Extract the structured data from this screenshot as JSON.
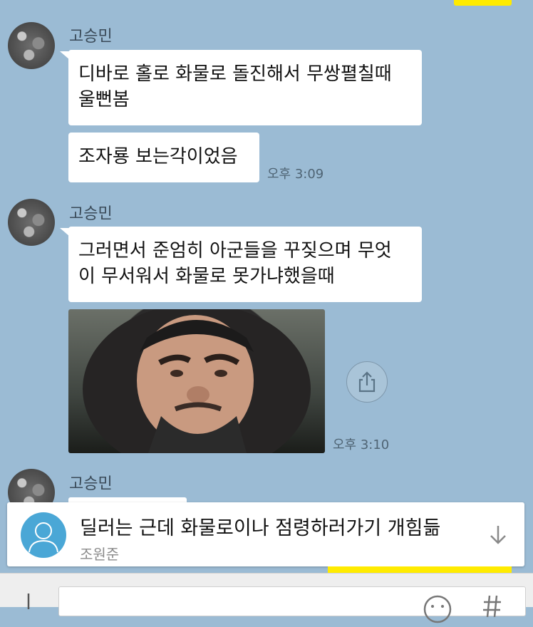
{
  "colors": {
    "chat_background": "#9bbbd4",
    "bubble": "#ffffff",
    "my_bubble": "#ffeb00",
    "timestamp": "#4f6474"
  },
  "messages": [
    {
      "sender": "고승민",
      "bubbles": [
        "디바로 홀로 화물로 돌진해서 무쌍펼칠때\n울뻔봄",
        "조자룡 보는각이었음"
      ],
      "time": "오후 3:09"
    },
    {
      "sender": "고승민",
      "bubbles": [
        "그러면서 준엄히 아군들을 꾸짖으며 무엇\n이 무서워서 화물로 못가냐했을때"
      ],
      "image": {
        "icon": "photo",
        "share_icon": "share-icon"
      },
      "time": "오후 3:10"
    },
    {
      "sender": "고승민"
    }
  ],
  "notice": {
    "text": "딜러는 근데 화물로이나 점령하러가기 개힘듦",
    "sender": "조원준",
    "avatar_icon": "default-profile-icon",
    "expand_icon": "arrow-down-icon"
  },
  "input_bar": {
    "menu_icon": "plus-icon",
    "emoji_icon": "emoji-icon",
    "hash_icon": "hash-icon"
  }
}
